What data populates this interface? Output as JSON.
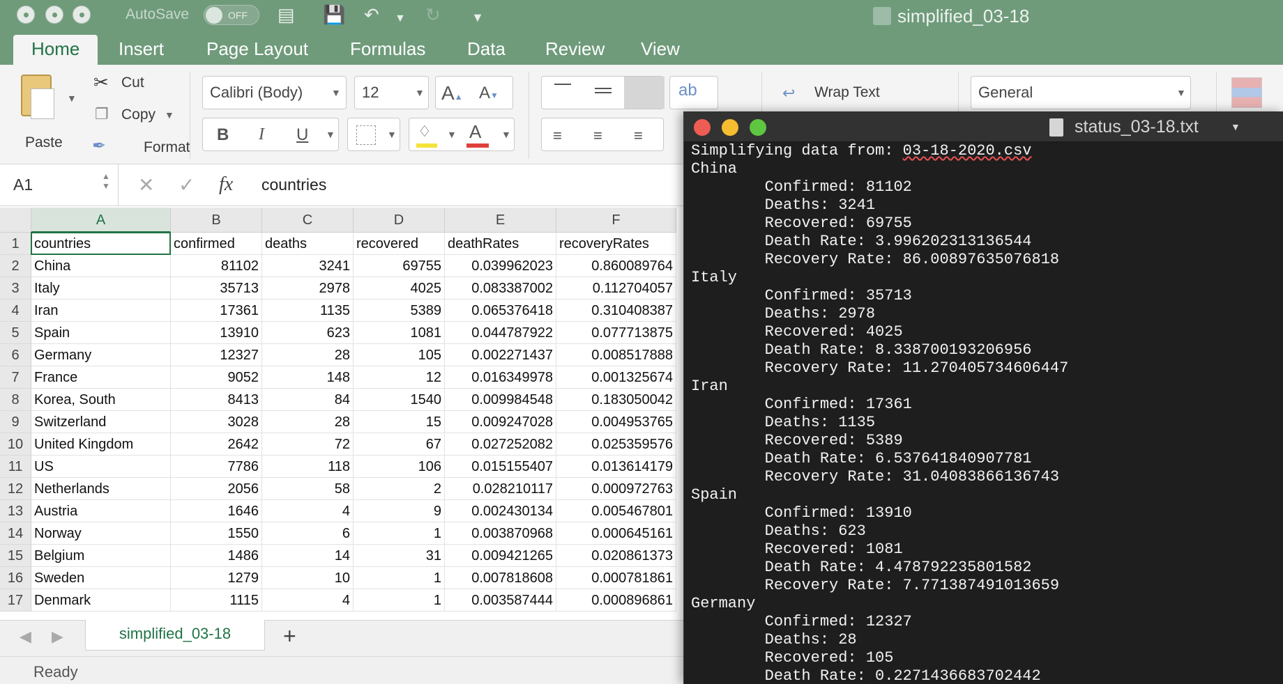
{
  "excel": {
    "autosave_label": "AutoSave",
    "autosave_state": "OFF",
    "document_title": "simplified_03-18",
    "tabs": [
      "Home",
      "Insert",
      "Page Layout",
      "Formulas",
      "Data",
      "Review",
      "View"
    ],
    "ribbon": {
      "paste": "Paste",
      "cut": "Cut",
      "copy": "Copy",
      "format": "Format",
      "font_name": "Calibri (Body)",
      "font_size": "12",
      "bold": "B",
      "italic": "I",
      "underline": "U",
      "wrap_text": "Wrap Text",
      "number_format": "General"
    },
    "name_box": "A1",
    "formula": "countries",
    "columns": [
      "A",
      "B",
      "C",
      "D",
      "E",
      "F"
    ],
    "headers": [
      "countries",
      "confirmed",
      "deaths",
      "recovered",
      "deathRates",
      "recoveryRates"
    ],
    "rows": [
      [
        "China",
        "81102",
        "3241",
        "69755",
        "0.039962023",
        "0.860089764"
      ],
      [
        "Italy",
        "35713",
        "2978",
        "4025",
        "0.083387002",
        "0.112704057"
      ],
      [
        "Iran",
        "17361",
        "1135",
        "5389",
        "0.065376418",
        "0.310408387"
      ],
      [
        "Spain",
        "13910",
        "623",
        "1081",
        "0.044787922",
        "0.077713875"
      ],
      [
        "Germany",
        "12327",
        "28",
        "105",
        "0.002271437",
        "0.008517888"
      ],
      [
        "France",
        "9052",
        "148",
        "12",
        "0.016349978",
        "0.001325674"
      ],
      [
        "Korea, South",
        "8413",
        "84",
        "1540",
        "0.009984548",
        "0.183050042"
      ],
      [
        "Switzerland",
        "3028",
        "28",
        "15",
        "0.009247028",
        "0.004953765"
      ],
      [
        "United Kingdom",
        "2642",
        "72",
        "67",
        "0.027252082",
        "0.025359576"
      ],
      [
        "US",
        "7786",
        "118",
        "106",
        "0.015155407",
        "0.013614179"
      ],
      [
        "Netherlands",
        "2056",
        "58",
        "2",
        "0.028210117",
        "0.000972763"
      ],
      [
        "Austria",
        "1646",
        "4",
        "9",
        "0.002430134",
        "0.005467801"
      ],
      [
        "Norway",
        "1550",
        "6",
        "1",
        "0.003870968",
        "0.000645161"
      ],
      [
        "Belgium",
        "1486",
        "14",
        "31",
        "0.009421265",
        "0.020861373"
      ],
      [
        "Sweden",
        "1279",
        "10",
        "1",
        "0.007818608",
        "0.000781861"
      ],
      [
        "Denmark",
        "1115",
        "4",
        "1",
        "0.003587444",
        "0.000896861"
      ]
    ],
    "sheet_tab": "simplified_03-18",
    "add_sheet": "+",
    "status": "Ready"
  },
  "textwin": {
    "title": "status_03-18.txt",
    "intro": "Simplifying data from: ",
    "csv_name": "03-18-2020.csv",
    "lines": [
      "China",
      "        Confirmed: 81102",
      "        Deaths: 3241",
      "        Recovered: 69755",
      "        Death Rate: 3.996202313136544",
      "        Recovery Rate: 86.00897635076818",
      "Italy",
      "        Confirmed: 35713",
      "        Deaths: 2978",
      "        Recovered: 4025",
      "        Death Rate: 8.338700193206956",
      "        Recovery Rate: 11.270405734606447",
      "Iran",
      "        Confirmed: 17361",
      "        Deaths: 1135",
      "        Recovered: 5389",
      "        Death Rate: 6.537641840907781",
      "        Recovery Rate: 31.04083866136743",
      "Spain",
      "        Confirmed: 13910",
      "        Deaths: 623",
      "        Recovered: 1081",
      "        Death Rate: 4.478792235801582",
      "        Recovery Rate: 7.771387491013659",
      "Germany",
      "        Confirmed: 12327",
      "        Deaths: 28",
      "        Recovered: 105",
      "        Death Rate: 0.2271436683702442"
    ]
  },
  "colors": {
    "excel_green": "#6f9b7b",
    "excel_accent": "#217346",
    "terminal_bg": "#1e1e1e",
    "close_red": "#ee5c54",
    "minimize_yellow": "#f5bd30",
    "zoom_green": "#5ec640"
  }
}
